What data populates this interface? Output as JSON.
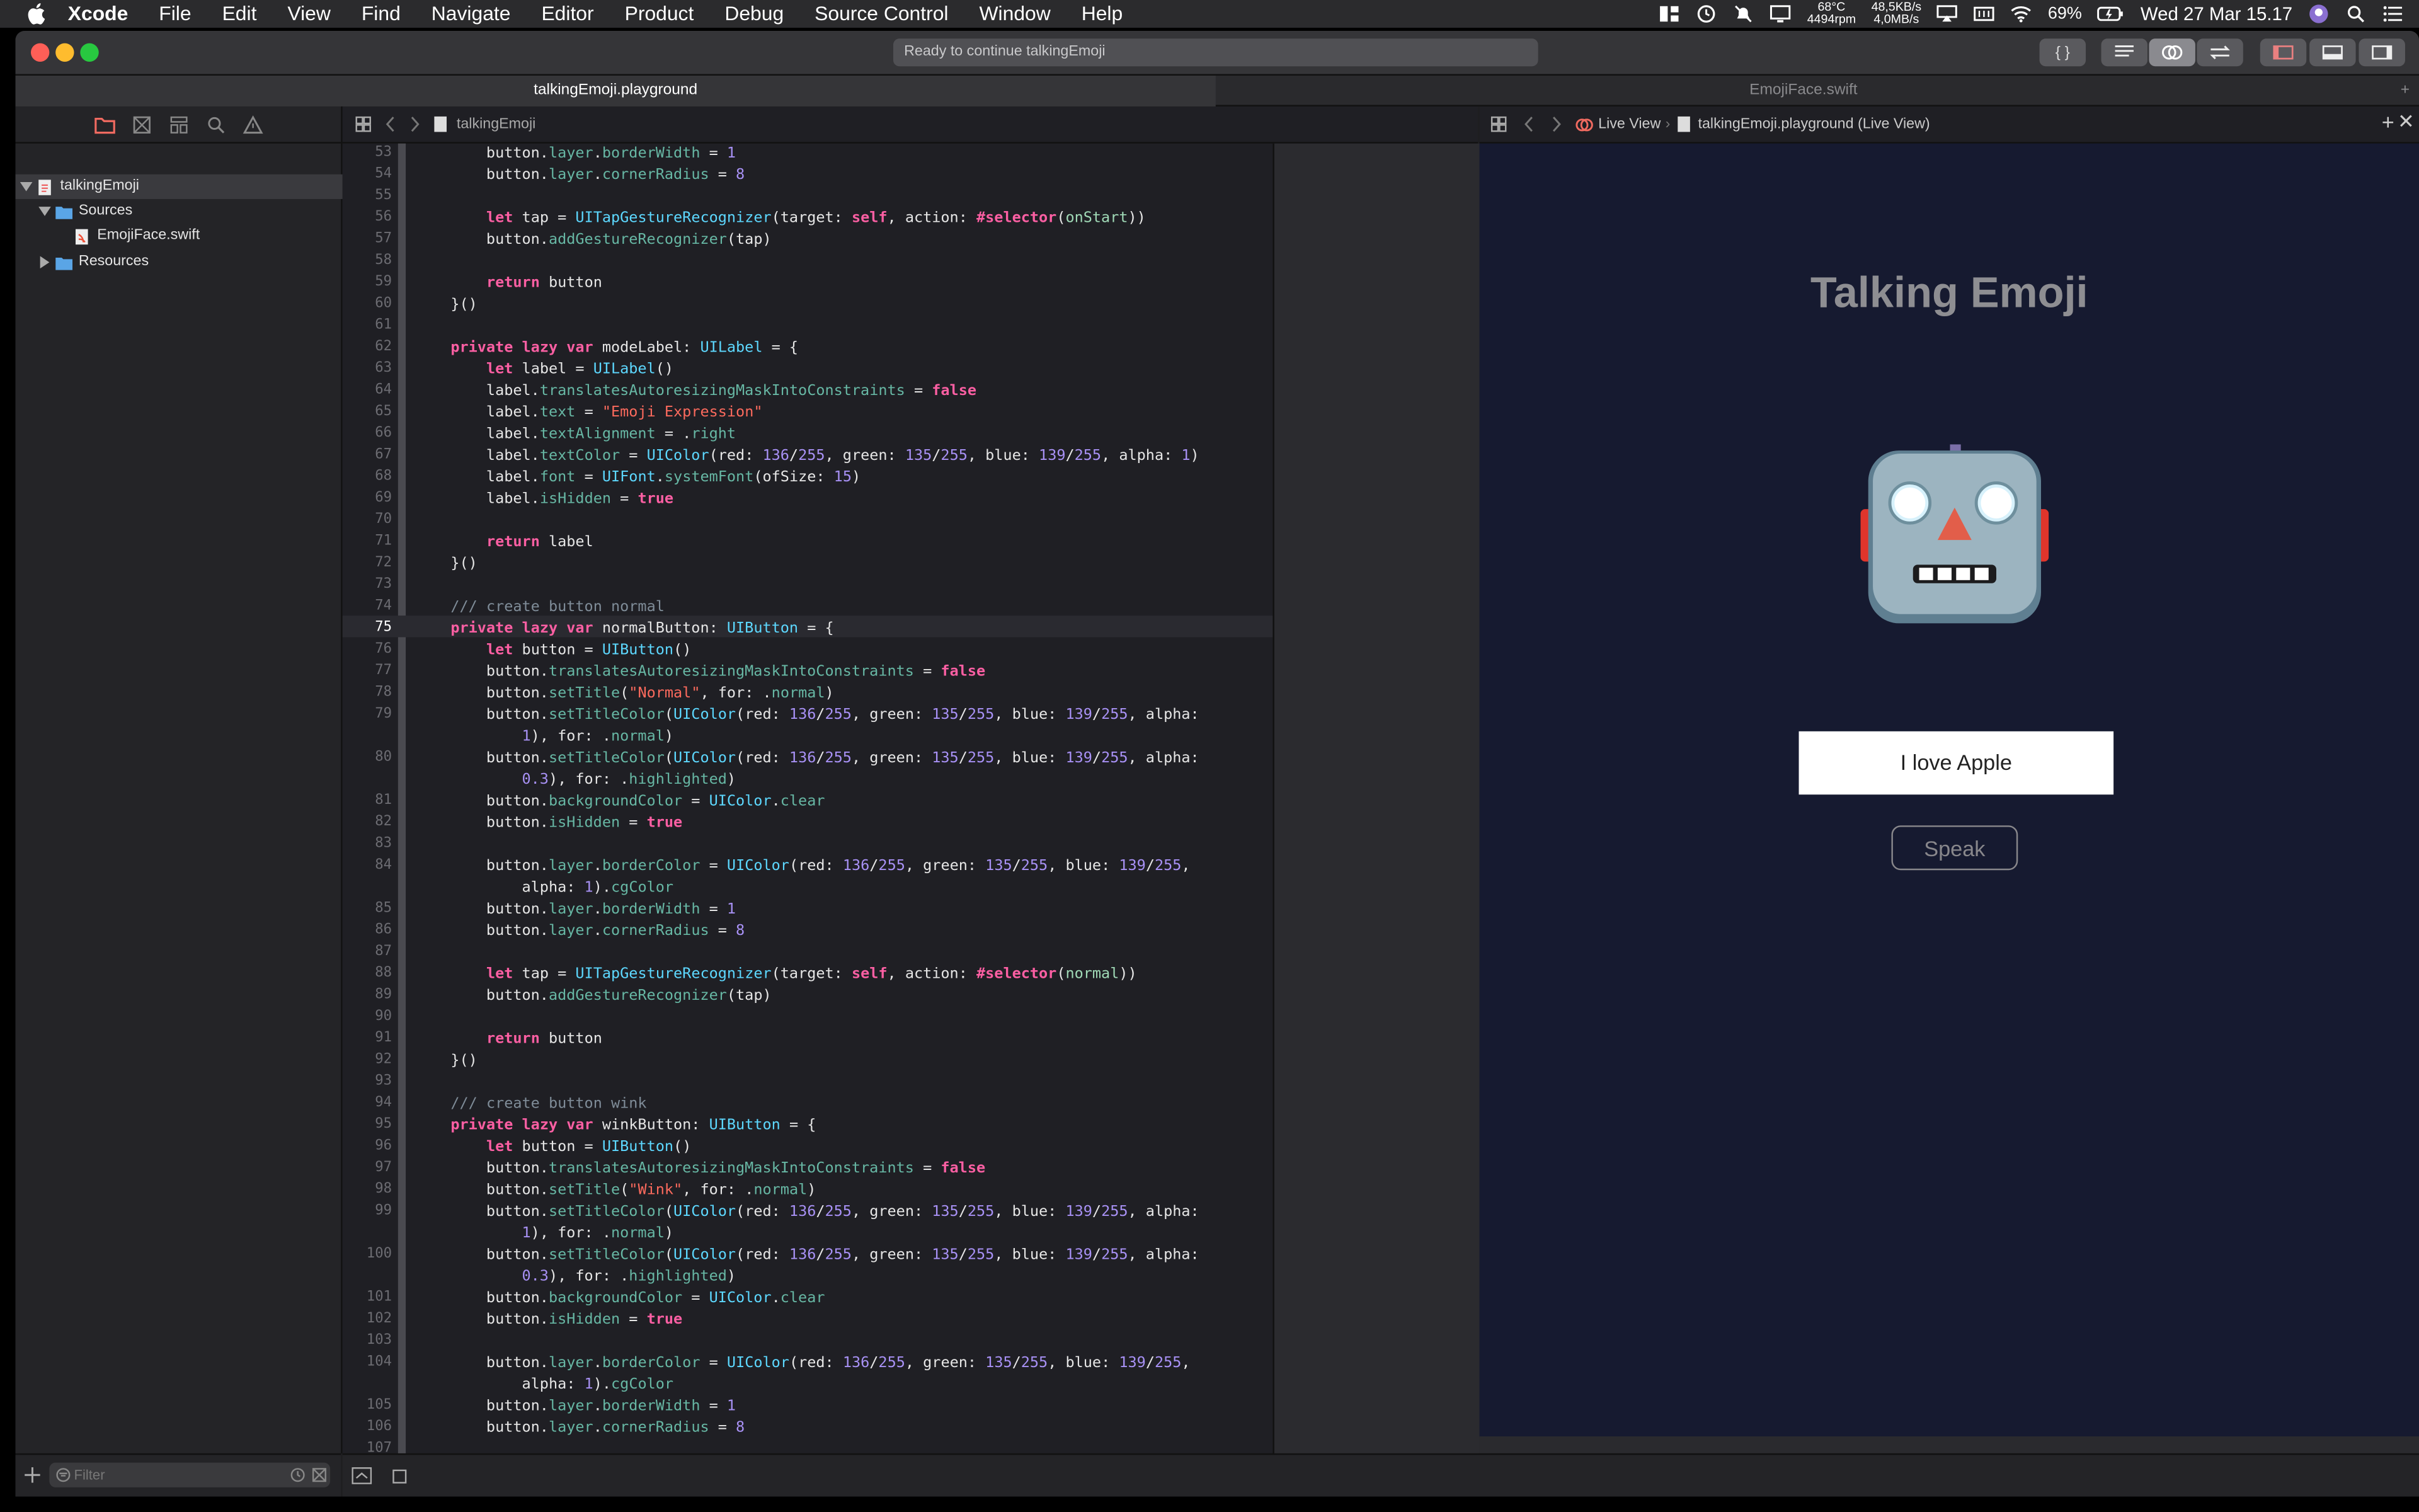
{
  "menubar": {
    "app": "Xcode",
    "items": [
      "File",
      "Edit",
      "View",
      "Find",
      "Navigate",
      "Editor",
      "Product",
      "Debug",
      "Source Control",
      "Window",
      "Help"
    ],
    "temp": "68°C",
    "rpm": "4494rpm",
    "net_up": "48,5KB/s",
    "net_down": "4,0MB/s",
    "battery": "69%",
    "clock": "Wed 27 Mar  15.17"
  },
  "window": {
    "status": "Ready to continue talkingEmoji",
    "tabs": [
      "talkingEmoji.playground",
      "EmojiFace.swift"
    ]
  },
  "navigator": {
    "tree": [
      {
        "label": "talkingEmoji",
        "level": 0
      },
      {
        "label": "Sources",
        "level": 1
      },
      {
        "label": "EmojiFace.swift",
        "level": 2
      },
      {
        "label": "Resources",
        "level": 1
      }
    ],
    "filter_placeholder": "Filter"
  },
  "editor": {
    "breadcrumb": "talkingEmoji",
    "current_line": 75
  },
  "liveview": {
    "breadcrumb_live": "Live View",
    "breadcrumb_file": "talkingEmoji.playground (Live View)",
    "title": "Talking Emoji",
    "input_text": "I love Apple",
    "speak_label": "Speak"
  }
}
